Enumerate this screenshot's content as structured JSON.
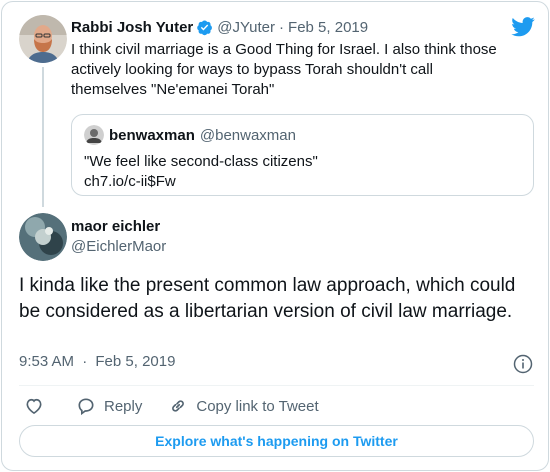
{
  "brand": {
    "color": "#1d9bf0",
    "logo_icon": "twitter-bird-icon"
  },
  "parent_tweet": {
    "author_name": "Rabbi Josh Yuter",
    "verified": true,
    "handle": "@JYuter",
    "separator": "·",
    "date": "Feb 5, 2019",
    "text": "I think civil marriage is a Good Thing for Israel. I also think those actively looking for ways to bypass Torah shouldn't call themselves \"Ne'emanei Torah\"",
    "quoted_tweet": {
      "author_name": "benwaxman",
      "handle": "@benwaxman",
      "text_line1": "\"We feel like second-class citizens\"",
      "text_line2": "ch7.io/c-ii$Fw"
    }
  },
  "main_tweet": {
    "author_name": "maor eichler",
    "handle": "@EichlerMaor",
    "text": "I kinda like the present common law approach, which could be considered as a libertarian version of civil law marriage.",
    "time": "9:53 AM",
    "separator": "·",
    "date": "Feb 5, 2019"
  },
  "actions": {
    "like_icon": "heart-icon",
    "reply_label": "Reply",
    "copy_link_label": "Copy link to Tweet"
  },
  "explore_label": "Explore what's happening on Twitter"
}
